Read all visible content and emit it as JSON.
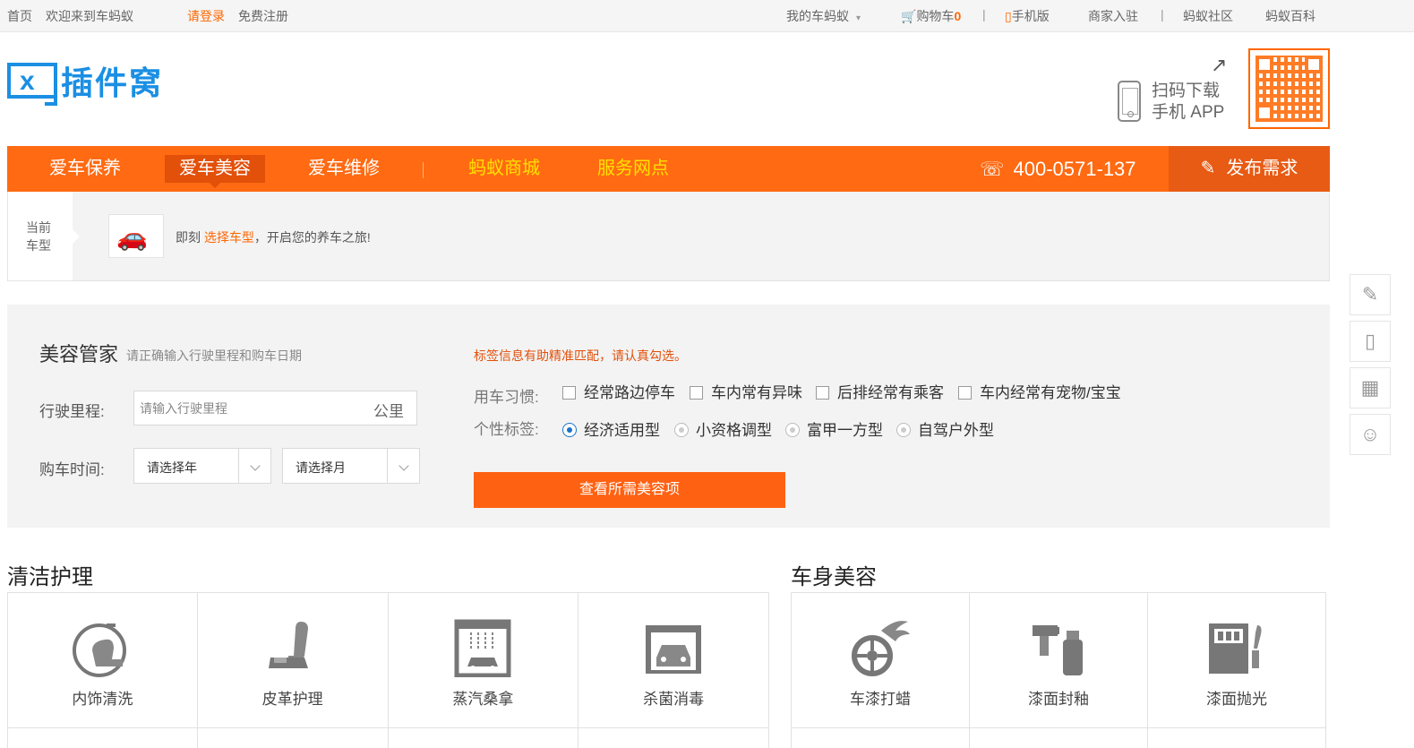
{
  "topbar": {
    "home": "首页",
    "welcome": "欢迎来到车蚂蚁",
    "login": "请登录",
    "register": "免费注册",
    "my_account": "我的车蚂蚁",
    "cart_label": "购物车",
    "cart_count": "0",
    "mobile": "手机版",
    "merchant": "商家入驻",
    "community": "蚂蚁社区",
    "wiki": "蚂蚁百科"
  },
  "header": {
    "logo_text": "插件窝",
    "app_line1": "扫码下载",
    "app_line2": "手机 APP"
  },
  "nav": {
    "items": [
      "爱车保养",
      "爱车美容",
      "爱车维修",
      "蚂蚁商城",
      "服务网点"
    ],
    "phone": "400-0571-137",
    "publish": "发布需求"
  },
  "car": {
    "label_line1": "当前",
    "label_line2": "车型",
    "prompt_before": "即刻",
    "prompt_link": "选择车型",
    "prompt_after": "，开启您的养车之旅!"
  },
  "manager": {
    "title": "美容管家",
    "subtitle": "请正确输入行驶里程和购车日期",
    "mileage_label": "行驶里程:",
    "mileage_placeholder": "请输入行驶里程",
    "mileage_unit": "公里",
    "date_label": "购车时间:",
    "year_select": "请选择年",
    "month_select": "请选择月",
    "tag_hint": "标签信息有助精准匹配，请认真勾选。",
    "habit_label": "用车习惯:",
    "habits": [
      "经常路边停车",
      "车内常有异味",
      "后排经常有乘客",
      "车内经常有宠物/宝宝"
    ],
    "personality_label": "个性标签:",
    "personalities": [
      "经济适用型",
      "小资格调型",
      "富甲一方型",
      "自驾户外型"
    ],
    "search_button": "查看所需美容项"
  },
  "categories": {
    "cleaning_title": "清洁护理",
    "cleaning_items": [
      "内饰清洗",
      "皮革护理",
      "蒸汽桑拿",
      "杀菌消毒"
    ],
    "body_title": "车身美容",
    "body_items": [
      "车漆打蜡",
      "漆面封釉",
      "漆面抛光"
    ]
  },
  "colors": {
    "brand_orange": "#ff6a12",
    "logo_blue": "#1a8fe3"
  }
}
